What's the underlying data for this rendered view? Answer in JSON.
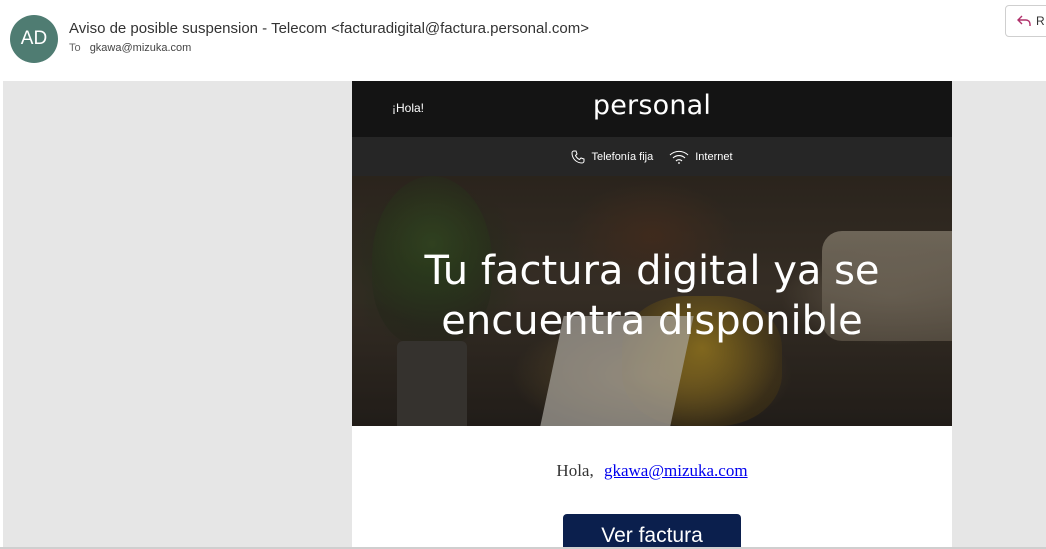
{
  "message": {
    "avatar_initials": "AD",
    "subject_line": "Aviso de posible suspension - Telecom <facturadigital@factura.personal.com>",
    "to_label": "To",
    "to_address": "gkawa@mizuka.com",
    "reply_label": "R"
  },
  "email": {
    "greeting_top": "¡Hola!",
    "brand": "personal",
    "nav": [
      {
        "label": "Telefonía fija",
        "icon": "phone-icon"
      },
      {
        "label": "Internet",
        "icon": "wifi-icon"
      }
    ],
    "hero_title_line1": "Tu factura digital ya se",
    "hero_title_line2": "encuentra disponible",
    "greeting_prefix": "Hola,",
    "greeting_email": "gkawa@mizuka.com",
    "cta_label": "Ver factura"
  },
  "colors": {
    "avatar": "#4f7c72",
    "topbar": "#141414",
    "navbar": "#262626",
    "cta": "#0b1f4d",
    "link": "#0000ee"
  }
}
